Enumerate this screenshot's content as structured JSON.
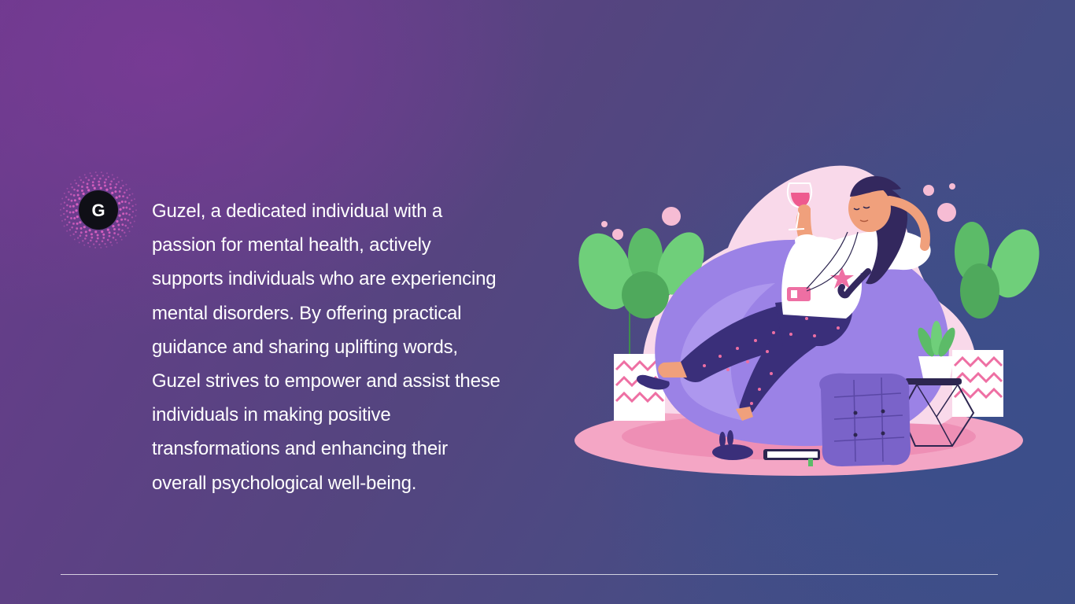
{
  "brand": {
    "logo_letter": "G",
    "colors": {
      "dots": "#d65fc0",
      "badge": "#0f0f16",
      "letter": "#ffffff"
    }
  },
  "bio": {
    "lines": [
      "Guzel, a dedicated individual with a",
      "passion for mental health, actively",
      "supports individuals who are experiencing",
      "mental disorders. By offering practical",
      "guidance and sharing uplifting words,",
      "Guzel strives to empower and assist these",
      "individuals in making positive",
      "transformations and enhancing their",
      "overall psychological well-being."
    ]
  },
  "illustration": {
    "subject": "woman relaxing on bean bag with wine glass",
    "colors": {
      "rug": "#f4a6c5",
      "blob": "#f9d9ea",
      "beanbag": "#9b82e6",
      "pants": "#3a2f7a",
      "shirt": "#ffffff",
      "hair": "#33285e",
      "skin": "#f0a07c",
      "leaves": "#5fc06a",
      "pillow": "#7a63c9"
    }
  },
  "theme": {
    "text_color": "#ffffff",
    "divider_color": "#ffffff"
  }
}
